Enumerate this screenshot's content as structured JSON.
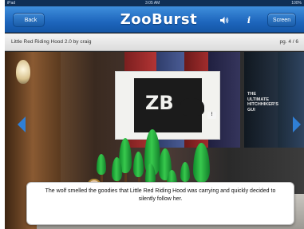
{
  "status_bar": {
    "carrier": "iPad",
    "time": "3:05 AM",
    "battery": "100%"
  },
  "nav": {
    "back_label": "Back",
    "app_title": "ZooBurst",
    "sound_icon": "speaker-icon",
    "info_label": "i",
    "screen_label": "Screen",
    "accent": "#1e66bd"
  },
  "book": {
    "title": "Little Red Riding Hood 2.0 by craig",
    "page_indicator": "pg. 4 / 6"
  },
  "scene": {
    "card_letters": "ZB",
    "book_spine_text": "THE ULTIMATE HITCHHIKER'S GUI",
    "comment_label": "!"
  },
  "caption": "The wolf smelled the goodies that Little Red Riding Hood was carrying and quickly decided to silently follow her."
}
